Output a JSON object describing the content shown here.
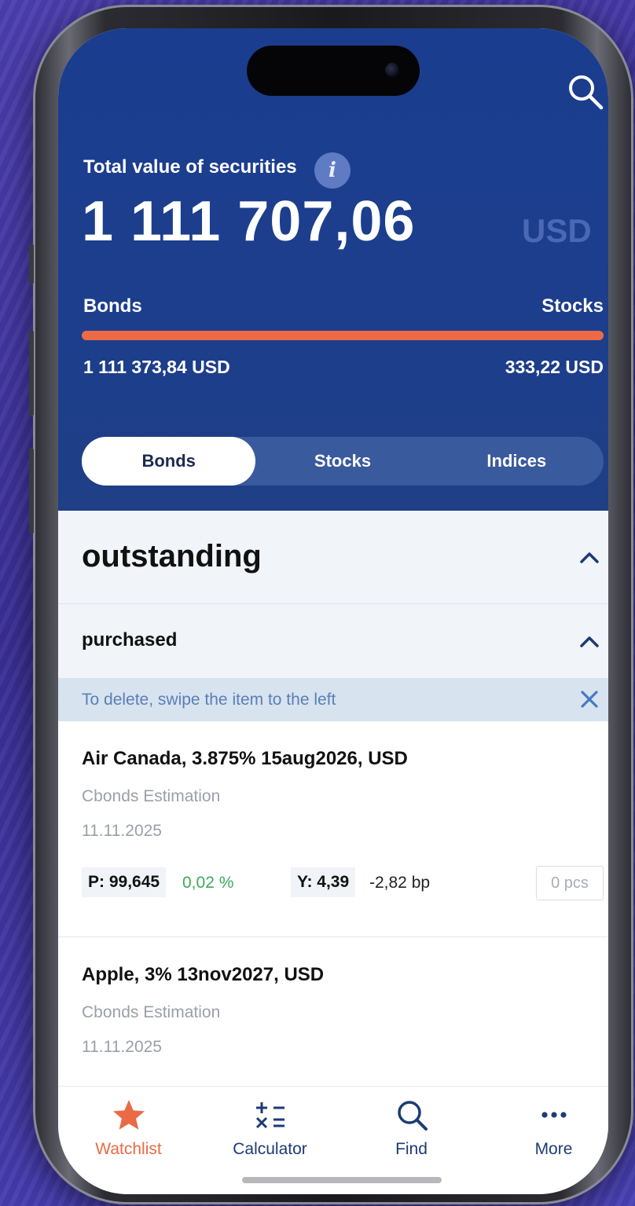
{
  "header": {
    "total_label": "Total value of securities",
    "info_icon": "i",
    "total_value": "1 111 707,06",
    "currency": "USD",
    "split": {
      "left_label": "Bonds",
      "right_label": "Stocks",
      "left_value": "1 111 373,84 USD",
      "right_value": "333,22 USD",
      "bonds_share": 0.9997,
      "bonds_color": "#ed6a47",
      "stocks_color": "#3c66d0"
    },
    "segments": [
      {
        "label": "Bonds",
        "active": true
      },
      {
        "label": "Stocks",
        "active": false
      },
      {
        "label": "Indices",
        "active": false
      }
    ]
  },
  "list": {
    "section_title": "outstanding",
    "subsection_title": "purchased",
    "hint": "To delete, swipe the item to the left",
    "items": [
      {
        "title": "Air Canada, 3.875% 15aug2026, USD",
        "source": "Cbonds Estimation",
        "date": "11.11.2025",
        "price": "P: 99,645",
        "price_change": "0,02 %",
        "yield": "Y: 4,39",
        "yield_change": "-2,82 bp",
        "qty_placeholder": "0 pcs"
      },
      {
        "title": "Apple, 3% 13nov2027, USD",
        "source": "Cbonds Estimation",
        "date": "11.11.2025"
      }
    ]
  },
  "tabbar": {
    "items": [
      {
        "label": "Watchlist",
        "icon": "star-icon",
        "active": true
      },
      {
        "label": "Calculator",
        "icon": "calculator-icon",
        "active": false
      },
      {
        "label": "Find",
        "icon": "search-icon",
        "active": false
      },
      {
        "label": "More",
        "icon": "more-icon",
        "active": false
      }
    ]
  },
  "colors": {
    "header_bg": "#1c3e8c",
    "accent": "#ea6a45",
    "positive": "#3daa58",
    "hint_text": "#5a7fb6"
  }
}
